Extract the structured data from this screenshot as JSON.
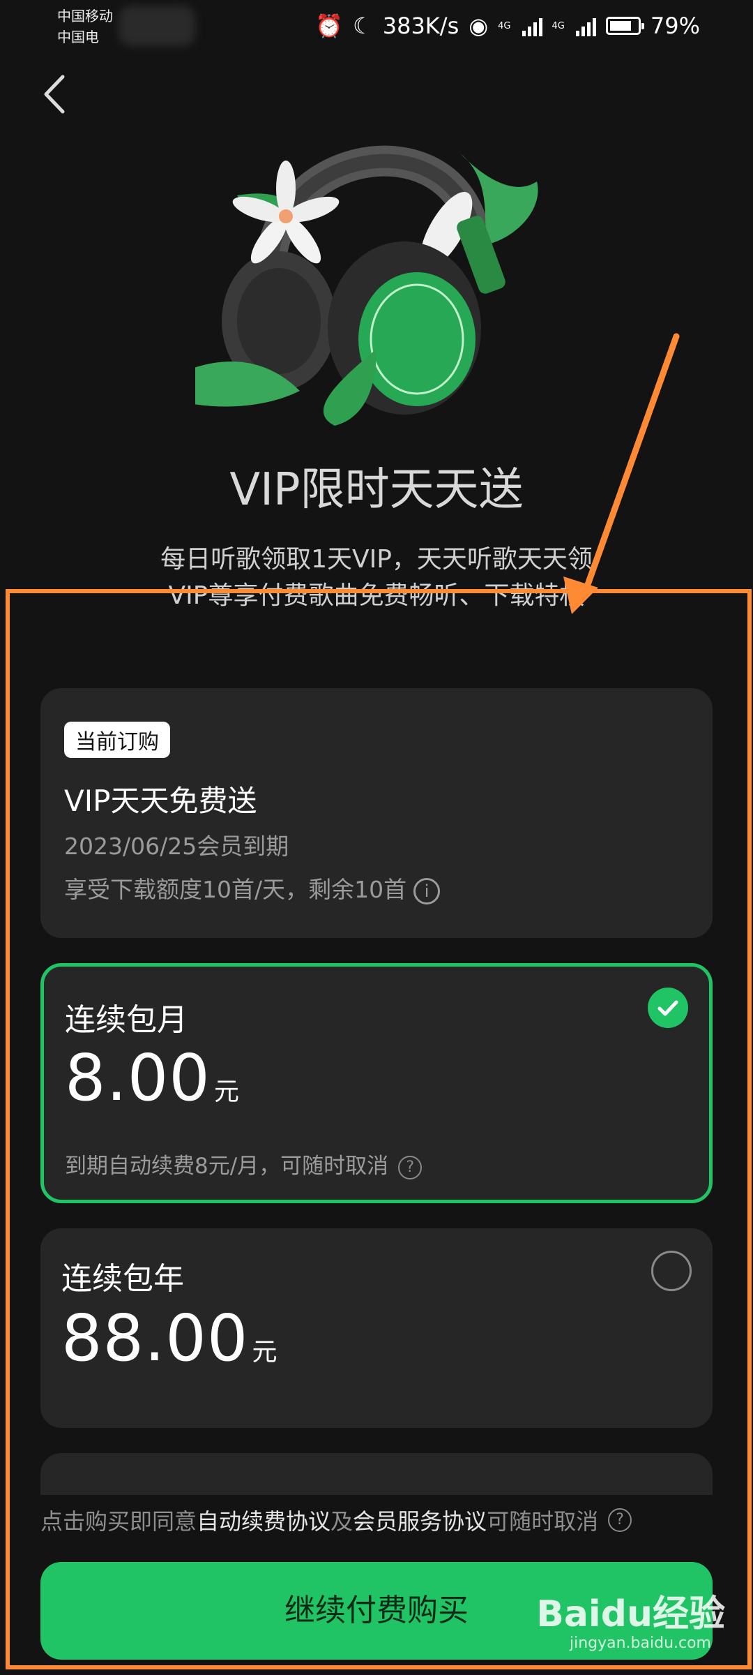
{
  "status_bar": {
    "carrier_1": "中国移动",
    "carrier_2": "中国电",
    "speed": "383K/s",
    "battery": "79%",
    "net_tag_1": "4G",
    "net_tag_2": "4G"
  },
  "header": {
    "title": "VIP限时天天送",
    "subtitle_line1": "每日听歌领取1天VIP，天天听歌天天领",
    "subtitle_line2": "VIP尊享付费歌曲免费畅听、下载特权"
  },
  "current": {
    "badge": "当前订购",
    "plan": "VIP天天免费送",
    "expiry": "2023/06/25会员到期",
    "quota": "享受下载额度10首/天，剩余10首"
  },
  "plans": [
    {
      "name": "连续包月",
      "price": "8.00",
      "unit": "元",
      "note": "到期自动续费8元/月，可随时取消",
      "selected": true
    },
    {
      "name": "连续包年",
      "price": "88.00",
      "unit": "元",
      "selected": false
    }
  ],
  "footer": {
    "agree_prefix": "点击购买即同意",
    "agree_link1": "自动续费协议",
    "agree_mid": "及",
    "agree_link2": "会员服务协议",
    "agree_suffix": "可随时取消",
    "cta": "继续付费购买"
  },
  "watermark": {
    "brand": "Baidu经验",
    "url": "jingyan.baidu.com"
  },
  "colors": {
    "accent": "#20c464",
    "annotation": "#ff8a34",
    "background": "#131313",
    "card": "#262626"
  }
}
